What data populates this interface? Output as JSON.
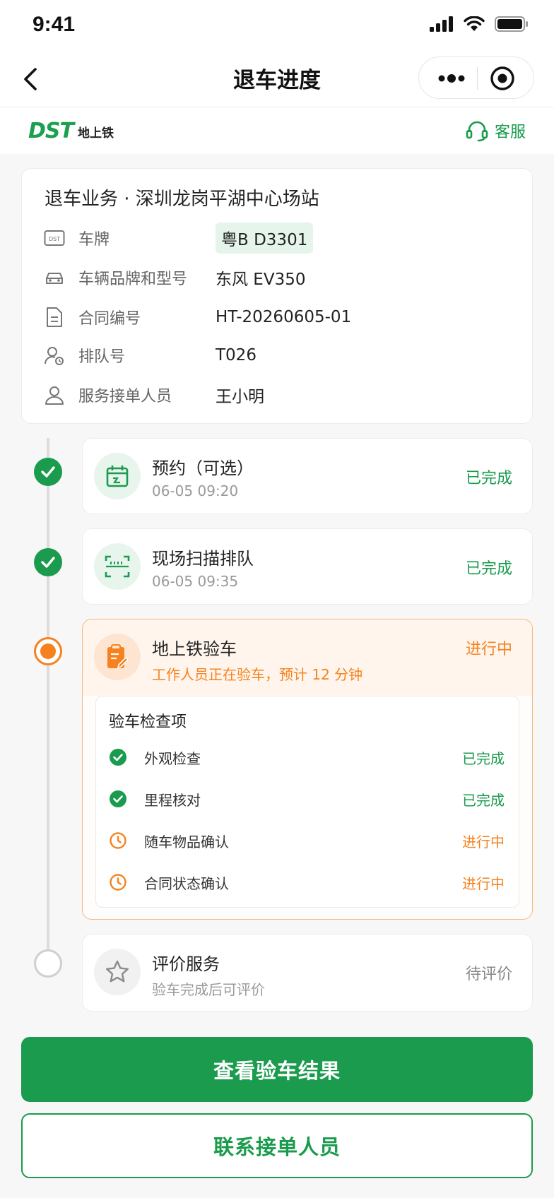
{
  "status_bar": {
    "time": "9:41"
  },
  "nav": {
    "title": "退车进度"
  },
  "brand": {
    "logo_mark": "DST",
    "logo_text": "地上铁",
    "service_label": "客服"
  },
  "info": {
    "title": "退车业务 · 深圳龙岗平湖中心场站",
    "rows": [
      {
        "icon": "plate-icon",
        "label": "车牌",
        "value": "粤B D3301"
      },
      {
        "icon": "car-icon",
        "label": "车辆品牌和型号",
        "value": "东风 EV350"
      },
      {
        "icon": "document-icon",
        "label": "合同编号",
        "value": "HT-20260605-01"
      },
      {
        "icon": "queue-icon",
        "label": "排队号",
        "value": "T026"
      },
      {
        "icon": "person-icon",
        "label": "服务接单人员",
        "value": "王小明"
      }
    ]
  },
  "steps": [
    {
      "icon": "calendar-icon",
      "title": "预约（可选）",
      "time": "06-05 09:20",
      "status": "已完成"
    },
    {
      "icon": "scan-icon",
      "title": "现场扫描排队",
      "time": "06-05 09:35",
      "status": "已完成"
    },
    {
      "icon": "clipboard-icon",
      "title": "地上铁验车",
      "subtitle": "工作人员正在验车，预计 12 分钟",
      "status": "进行中"
    },
    {
      "icon": "star-icon",
      "title": "评价服务",
      "subtitle": "验车完成后可评价",
      "status": "待评价"
    }
  ],
  "checklist": {
    "title": "验车检查项",
    "items": [
      {
        "label": "外观检查",
        "status": "已完成"
      },
      {
        "label": "里程核对",
        "status": "已完成"
      },
      {
        "label": "随车物品确认",
        "status": "进行中"
      },
      {
        "label": "合同状态确认",
        "status": "进行中"
      }
    ]
  },
  "actions": {
    "primary": "查看验车结果",
    "secondary": "联系接单人员"
  },
  "colors": {
    "brand_green": "#1a9b4d",
    "active_orange": "#f5821f",
    "pending_gray": "#cfcfcf"
  }
}
